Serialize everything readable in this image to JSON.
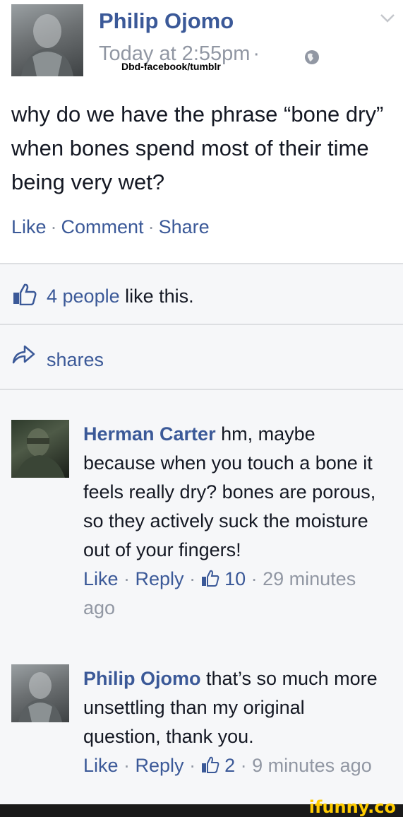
{
  "post": {
    "author": "Philip Ojomo",
    "time": "Today at 2:55pm",
    "time_sep": "·",
    "watermark": "Dbd-facebook/tumblr",
    "text": "why do we have the phrase “bone dry” when bones spend most of their time being very wet?",
    "actions": {
      "like": "Like",
      "comment": "Comment",
      "share": "Share",
      "sep": "·"
    }
  },
  "likes": {
    "count_text": "4 people",
    "suffix": " like this."
  },
  "shares": {
    "label": "shares"
  },
  "comments": [
    {
      "author": "Herman Carter",
      "text": " hm, maybe because when you touch a bone it feels really dry? bones are porous, so they actively suck the moisture out of your fingers!",
      "like": "Like",
      "reply": "Reply",
      "likes": "10",
      "time": "29 minutes ago",
      "sep": " · "
    },
    {
      "author": "Philip Ojomo",
      "text": " that’s so much more unsettling than my original question, thank you.",
      "like": "Like",
      "reply": "Reply",
      "likes": "2",
      "time": "9 minutes ago",
      "sep": " · "
    }
  ],
  "footer": {
    "brand": "ifunny.co"
  },
  "colors": {
    "link": "#3b5998",
    "meta": "#9197a3",
    "text": "#141823",
    "panel": "#f6f7f9"
  }
}
